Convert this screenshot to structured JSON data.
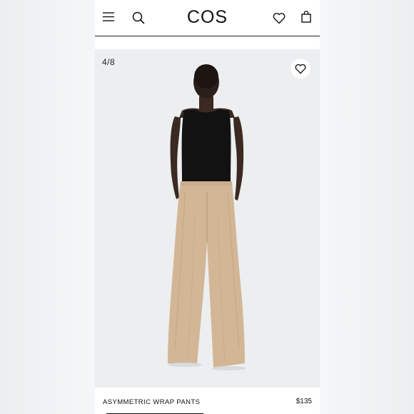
{
  "header": {
    "logo": "COS",
    "icons": [
      "menu-icon",
      "search-icon",
      "heart-icon",
      "bag-icon"
    ]
  },
  "gallery": {
    "counter": "4/8",
    "current_index": 4,
    "total_images": 8,
    "favorite_icon": "heart-icon"
  },
  "product": {
    "name": "ASYMMETRIC WRAP PANTS",
    "price": "$135"
  },
  "colors": {
    "background": "#eceeef",
    "text": "#111111",
    "top": "#111111",
    "pants": "#d2b695",
    "skin": "#3a2a22"
  }
}
